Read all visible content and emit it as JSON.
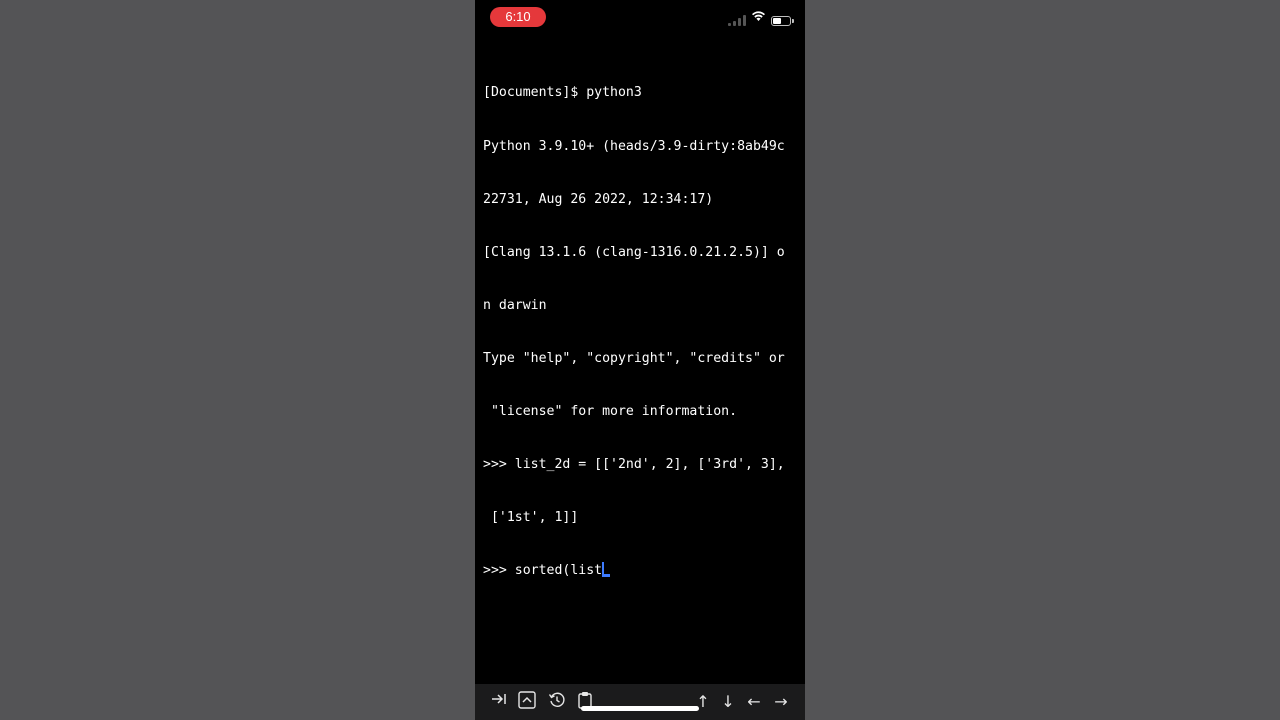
{
  "status_bar": {
    "time": "6:10",
    "icons": [
      "cellular-signal-icon",
      "wifi-icon",
      "battery-icon"
    ],
    "time_pill_color": "#e5383b"
  },
  "terminal": {
    "lines": [
      "[Documents]$ python3",
      "Python 3.9.10+ (heads/3.9-dirty:8ab49c",
      "22731, Aug 26 2022, 12:34:17)",
      "[Clang 13.1.6 (clang-1316.0.21.2.5)] o",
      "n darwin",
      "Type \"help\", \"copyright\", \"credits\" or",
      " \"license\" for more information.",
      ">>> list_2d = [['2nd', 2], ['3rd', 3],",
      " ['1st', 1]]"
    ],
    "current_input": ">>> sorted(list",
    "cursor_color": "#3d7bff"
  },
  "toolbar": {
    "buttons": [
      {
        "name": "tab-key-icon",
        "glyph": "⇥"
      },
      {
        "name": "control-key-icon",
        "glyph": "⌃"
      },
      {
        "name": "history-icon",
        "glyph": "↺"
      },
      {
        "name": "paste-icon",
        "glyph": "📋"
      },
      {
        "name": "arrow-up-icon",
        "glyph": "↑"
      },
      {
        "name": "arrow-down-icon",
        "glyph": "↓"
      },
      {
        "name": "arrow-left-icon",
        "glyph": "←"
      },
      {
        "name": "arrow-right-icon",
        "glyph": "→"
      }
    ]
  }
}
